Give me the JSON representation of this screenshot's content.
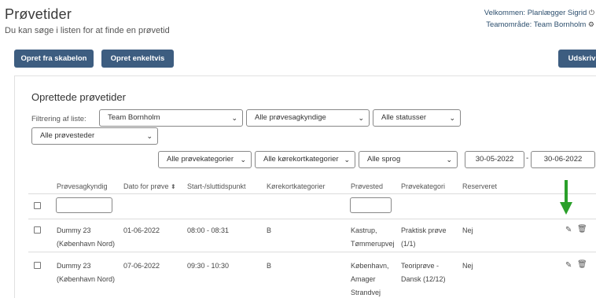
{
  "header": {
    "title": "Prøvetider",
    "subtitle": "Du kan søge i listen for at finde en prøvetid",
    "welcome": "Velkommen: Planlægger Sigrid",
    "team_area": "Teamområde: Team Bornholm"
  },
  "toolbar": {
    "from_template": "Opret fra skabelon",
    "single": "Opret enkeltvis",
    "print": "Udskriv"
  },
  "section": {
    "title": "Oprettede prøvetider",
    "filter_label": "Filtrering af liste:"
  },
  "filters": {
    "team": "Team Bornholm",
    "examiners": "Alle prøvesagkyndige",
    "statuses": "Alle statusser",
    "locations": "Alle prøvesteder",
    "exam_categories": "Alle prøvekategorier",
    "license_categories": "Alle kørekortkategorier",
    "languages": "Alle sprog",
    "date_from": "30-05-2022",
    "date_sep": "-",
    "date_to": "30-06-2022"
  },
  "table": {
    "columns": [
      "Prøvesagkyndig",
      "Dato for prøve",
      "Start-/sluttidspunkt",
      "Kørekortkategorier",
      "Prøvested",
      "Prøvekategori",
      "Reserveret"
    ],
    "rows": [
      {
        "examiner_1": "Dummy 23",
        "examiner_2": "(København Nord)",
        "date": "01-06-2022",
        "time": "08:00 - 08:31",
        "category": "B",
        "location_1": "Kastrup,",
        "location_2": "Tømmerupvej",
        "location_3": "",
        "exam_1": "Praktisk prøve",
        "exam_2": "(1/1)",
        "reserved": "Nej"
      },
      {
        "examiner_1": "Dummy 23",
        "examiner_2": "(København Nord)",
        "date": "07-06-2022",
        "time": "09:30 - 10:30",
        "category": "B",
        "location_1": "København,",
        "location_2": "Amager",
        "location_3": "Strandvej",
        "exam_1": "Teoriprøve -",
        "exam_2": "Dansk (12/12)",
        "reserved": "Nej"
      }
    ]
  },
  "icons": {
    "power": "power-icon",
    "gear": "gear-icon",
    "edit": "edit-icon",
    "trash": "trash-icon",
    "sort": "sort-icon",
    "annotation_arrow": "arrow-down-icon"
  },
  "colors": {
    "button": "#3d5d80",
    "arrow": "#2aa02a"
  }
}
